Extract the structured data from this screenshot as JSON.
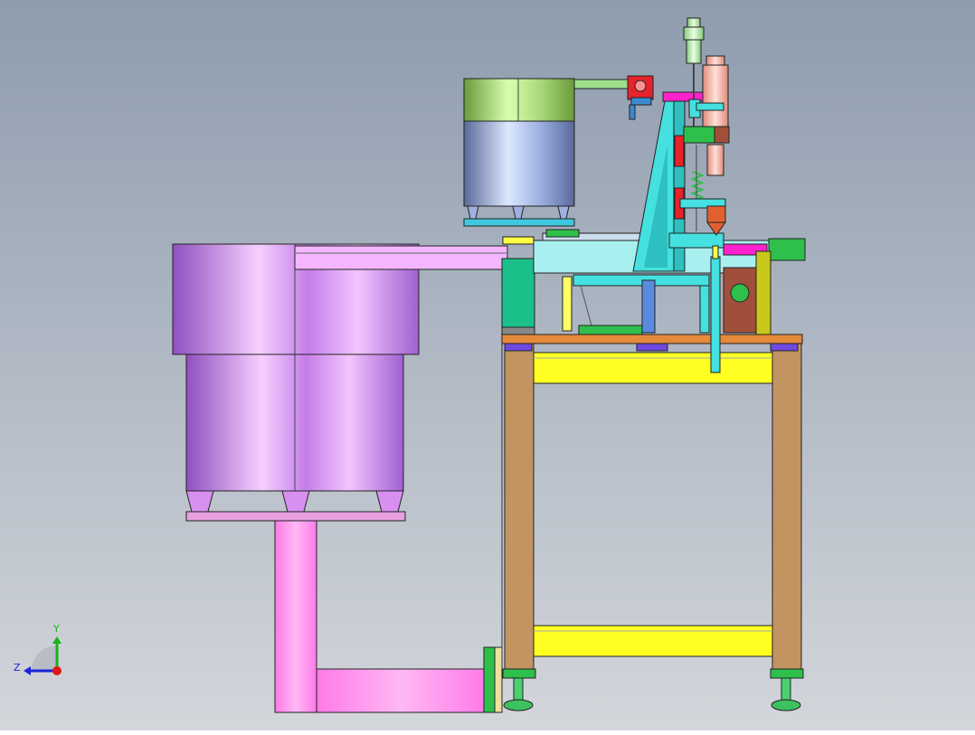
{
  "viewport": {
    "background_top": "#8e9cae",
    "background_bottom": "#d3d6db",
    "orientation_triad": {
      "axis_y_label": "Y",
      "axis_z_label": "Z",
      "axis_y_color": "#19b219",
      "axis_z_color": "#1a24d6",
      "axis_x_color": "#e01818"
    }
  },
  "colors": {
    "main_bowl": "#c07ae8",
    "main_bowl_light": "#f3c4ff",
    "chute": "#ff88ee",
    "small_bowl_top": "#9ccf66",
    "small_bowl_body": "#8fa3d8",
    "frame_leg": "#c29462",
    "frame_beam": "#ffff22",
    "table_top": "#e48a3a",
    "cyan_part": "#45e0e0",
    "teal_block": "#1bbf8a",
    "magenta_part": "#ff22cc",
    "red_part": "#e8222a",
    "green_part": "#2ec04a",
    "olive_block": "#c8c81a",
    "brown_block": "#a0503a",
    "cylinder_pink": "#f6b0a0",
    "cylinder_green": "#b8f0b0",
    "pad_blue": "#6e4ae0"
  }
}
